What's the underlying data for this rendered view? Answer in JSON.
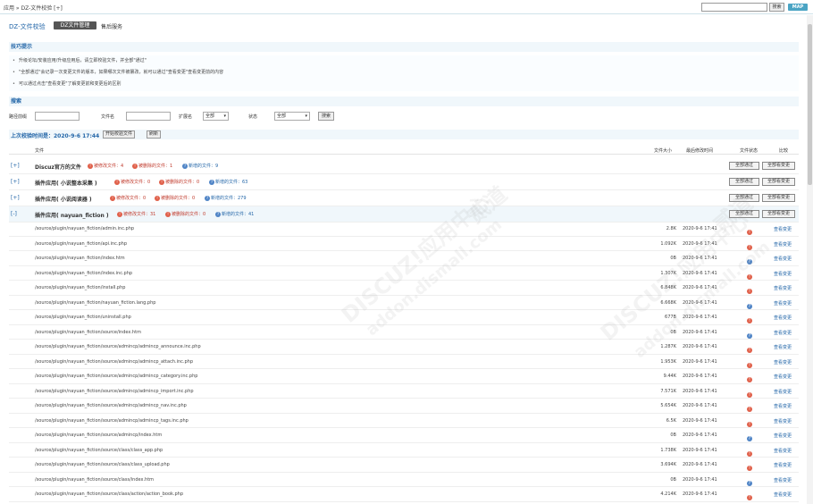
{
  "topbar": {
    "breadcrumb": "应用 » DZ-文件校验 [+]",
    "search_button": "搜索",
    "map_button": "MAP"
  },
  "header": {
    "title": "DZ-文件校验",
    "tab_active": "DZ文件管理",
    "tab_other": "售后服务"
  },
  "tips": {
    "heading": "技巧提示",
    "items": [
      "升级论坛/安装应用/升级应用后，请立即校验文件，并全部\"通过\"",
      "\"全部通过\"会记录一次变更文件的版本，如果哪次文件被篡改，就可以通过\"查看变更\"查看变更前的内容",
      "可以通过点击\"查看变更\"了解变更前和变更后的区别"
    ]
  },
  "search": {
    "heading": "搜索",
    "path_label": "路径前缀",
    "filename_label": "文件名",
    "ext_label": "扩展名",
    "ext_value": "全部",
    "status_label": "状态",
    "status_value": "全部",
    "button": "搜索"
  },
  "lastcheck": {
    "text": "上次校验时间是：2020-9-6 17:44",
    "start_button": "开始校验文件",
    "refresh_button": "刷新"
  },
  "columns": {
    "file": "文件",
    "size": "文件大小",
    "mtime": "最后修改时间",
    "status": "文件状态",
    "compare": "比较"
  },
  "groups": [
    {
      "toggle": "[+]",
      "name": "Discuz官方的文件",
      "modified": "被修改文件：4",
      "deleted": "被删除的文件：1",
      "added": "新增的文件：9",
      "btn_pass": "全部通过",
      "btn_view": "全部看变更"
    },
    {
      "toggle": "[+]",
      "name": "插件应用( 小说整本采集 )",
      "modified": "被修改文件：0",
      "deleted": "被删除的文件：0",
      "added": "新增的文件：63",
      "btn_pass": "全部通过",
      "btn_view": "全部看变更"
    },
    {
      "toggle": "[+]",
      "name": "插件应用( 小说阅读器 )",
      "modified": "被修改文件：0",
      "deleted": "被删除的文件：0",
      "added": "新增的文件：279",
      "btn_pass": "全部通过",
      "btn_view": "全部看变更"
    },
    {
      "toggle": "[-]",
      "name": "插件应用( nayuan_fiction )",
      "modified": "被修改文件：31",
      "deleted": "被删除的文件：0",
      "added": "新增的文件：41",
      "btn_pass": "全部通过",
      "btn_view": "全部看变更"
    }
  ],
  "files": [
    {
      "path": "/source/plugin/nayuan_fiction/admin.inc.php",
      "size": "2.8K",
      "mtime": "2020-9-6 17:41",
      "status": "red",
      "link": "查看变更"
    },
    {
      "path": "/source/plugin/nayuan_fiction/api.inc.php",
      "size": "1.092K",
      "mtime": "2020-9-6 17:41",
      "status": "red",
      "link": "查看变更"
    },
    {
      "path": "/source/plugin/nayuan_fiction/index.htm",
      "size": "0B",
      "mtime": "2020-9-6 17:41",
      "status": "blue",
      "link": "查看变更"
    },
    {
      "path": "/source/plugin/nayuan_fiction/index.inc.php",
      "size": "1.307K",
      "mtime": "2020-9-6 17:41",
      "status": "red",
      "link": "查看变更"
    },
    {
      "path": "/source/plugin/nayuan_fiction/install.php",
      "size": "6.848K",
      "mtime": "2020-9-6 17:41",
      "status": "red",
      "link": "查看变更"
    },
    {
      "path": "/source/plugin/nayuan_fiction/nayuan_fiction.lang.php",
      "size": "6.668K",
      "mtime": "2020-9-6 17:41",
      "status": "blue",
      "link": "查看变更"
    },
    {
      "path": "/source/plugin/nayuan_fiction/uninstall.php",
      "size": "677B",
      "mtime": "2020-9-6 17:41",
      "status": "red",
      "link": "查看变更"
    },
    {
      "path": "/source/plugin/nayuan_fiction/source/index.htm",
      "size": "0B",
      "mtime": "2020-9-6 17:41",
      "status": "blue",
      "link": "查看变更"
    },
    {
      "path": "/source/plugin/nayuan_fiction/source/admincp/admincp_announce.inc.php",
      "size": "1.287K",
      "mtime": "2020-9-6 17:41",
      "status": "red",
      "link": "查看变更"
    },
    {
      "path": "/source/plugin/nayuan_fiction/source/admincp/admincp_attach.inc.php",
      "size": "1.953K",
      "mtime": "2020-9-6 17:41",
      "status": "red",
      "link": "查看变更"
    },
    {
      "path": "/source/plugin/nayuan_fiction/source/admincp/admincp_category.inc.php",
      "size": "9.44K",
      "mtime": "2020-9-6 17:41",
      "status": "red",
      "link": "查看变更"
    },
    {
      "path": "/source/plugin/nayuan_fiction/source/admincp/admincp_import.inc.php",
      "size": "7.571K",
      "mtime": "2020-9-6 17:41",
      "status": "red",
      "link": "查看变更"
    },
    {
      "path": "/source/plugin/nayuan_fiction/source/admincp/admincp_nav.inc.php",
      "size": "5.654K",
      "mtime": "2020-9-6 17:41",
      "status": "red",
      "link": "查看变更"
    },
    {
      "path": "/source/plugin/nayuan_fiction/source/admincp/admincp_tags.inc.php",
      "size": "6.5K",
      "mtime": "2020-9-6 17:41",
      "status": "red",
      "link": "查看变更"
    },
    {
      "path": "/source/plugin/nayuan_fiction/source/admincp/index.htm",
      "size": "0B",
      "mtime": "2020-9-6 17:41",
      "status": "blue",
      "link": "查看变更"
    },
    {
      "path": "/source/plugin/nayuan_fiction/source/class/class_app.php",
      "size": "1.738K",
      "mtime": "2020-9-6 17:41",
      "status": "red",
      "link": "查看变更"
    },
    {
      "path": "/source/plugin/nayuan_fiction/source/class/class_upload.php",
      "size": "3.694K",
      "mtime": "2020-9-6 17:41",
      "status": "red",
      "link": "查看变更"
    },
    {
      "path": "/source/plugin/nayuan_fiction/source/class/index.htm",
      "size": "0B",
      "mtime": "2020-9-6 17:41",
      "status": "blue",
      "link": "查看变更"
    },
    {
      "path": "/source/plugin/nayuan_fiction/source/class/action/action_book.php",
      "size": "4.214K",
      "mtime": "2020-9-6 17:41",
      "status": "red",
      "link": "查看变更"
    }
  ],
  "watermark": {
    "a": "DISCUZ!应用中心",
    "b": "addon.dismall.com",
    "c": "贰道"
  },
  "icons": {
    "red_status": "warning-icon",
    "blue_status": "info-icon"
  },
  "colors": {
    "accent": "#2366a8",
    "danger": "#e0604a",
    "info": "#4f84c6"
  }
}
